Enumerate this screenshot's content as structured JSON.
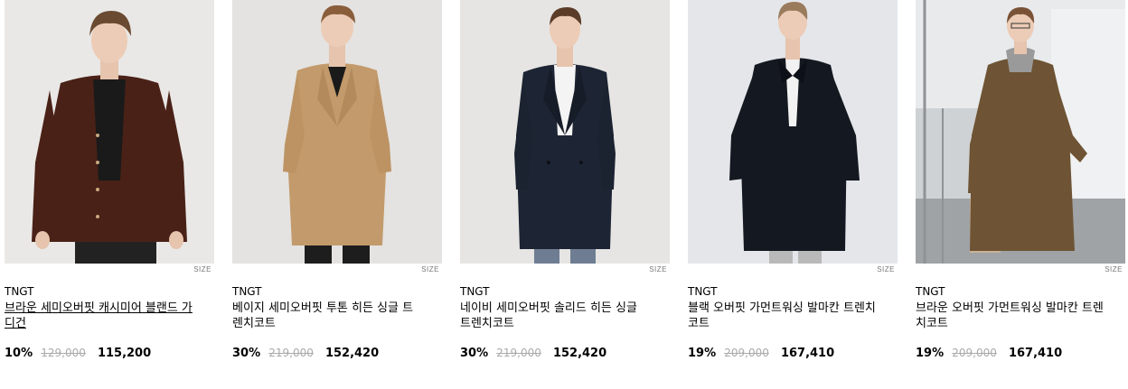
{
  "products": [
    {
      "brand": "TNGT",
      "title": "브라운 세미오버핏 캐시미어 블랜드 가디건",
      "discount": "10%",
      "original_price": "129,000",
      "sale_price": "115,200",
      "size_label": "SIZE"
    },
    {
      "brand": "TNGT",
      "title": "베이지 세미오버핏 투톤 히든 싱글 트렌치코트",
      "discount": "30%",
      "original_price": "219,000",
      "sale_price": "152,420",
      "size_label": "SIZE"
    },
    {
      "brand": "TNGT",
      "title": "네이비 세미오버핏 솔리드 히든 싱글 트렌치코트",
      "discount": "30%",
      "original_price": "219,000",
      "sale_price": "152,420",
      "size_label": "SIZE"
    },
    {
      "brand": "TNGT",
      "title": "블랙 오버핏 가먼트워싱 발마칸 트렌치코트",
      "discount": "19%",
      "original_price": "209,000",
      "sale_price": "167,410",
      "size_label": "SIZE"
    },
    {
      "brand": "TNGT",
      "title": "브라운 오버핏 가먼트워싱 발마칸 트렌치코트",
      "discount": "19%",
      "original_price": "209,000",
      "sale_price": "167,410",
      "size_label": "SIZE"
    }
  ],
  "colors": {
    "strike": "#aaaaaa",
    "text": "#000000"
  }
}
